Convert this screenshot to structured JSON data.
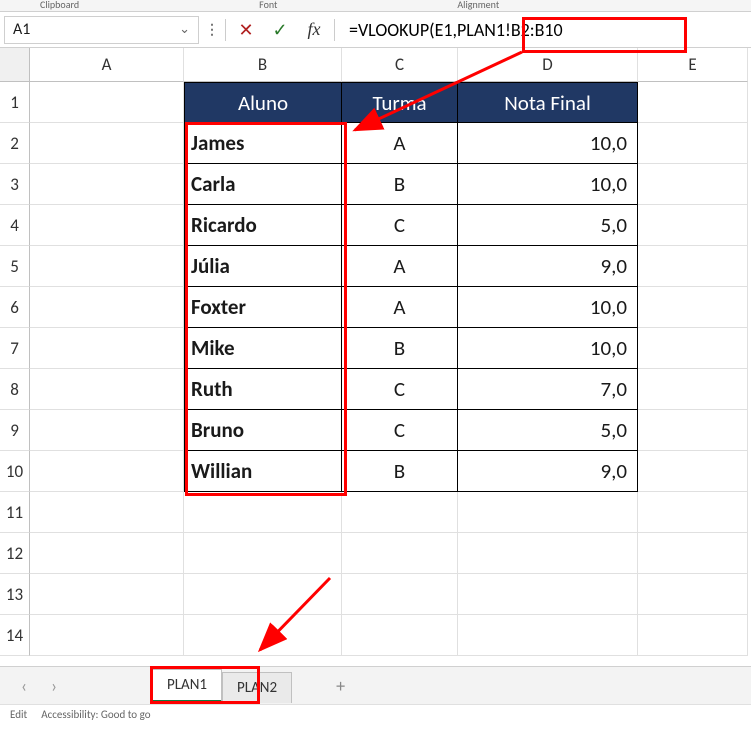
{
  "ribbon": {
    "group1": "Clipboard",
    "group2": "Font",
    "group3": "Alignment"
  },
  "name_box": "A1",
  "formula": "=VLOOKUP(E1,PLAN1!B2:B10",
  "columns": [
    "A",
    "B",
    "C",
    "D",
    "E"
  ],
  "rows": [
    "1",
    "2",
    "3",
    "4",
    "5",
    "6",
    "7",
    "8",
    "9",
    "10",
    "11",
    "12",
    "13",
    "14"
  ],
  "table": {
    "headers": {
      "aluno": "Aluno",
      "turma": "Turma",
      "nota": "Nota Final"
    },
    "data": [
      {
        "aluno": "James",
        "turma": "A",
        "nota": "10,0"
      },
      {
        "aluno": "Carla",
        "turma": "B",
        "nota": "10,0"
      },
      {
        "aluno": "Ricardo",
        "turma": "C",
        "nota": "5,0"
      },
      {
        "aluno": "Júlia",
        "turma": "A",
        "nota": "9,0"
      },
      {
        "aluno": "Foxter",
        "turma": "A",
        "nota": "10,0"
      },
      {
        "aluno": "Mike",
        "turma": "B",
        "nota": "10,0"
      },
      {
        "aluno": "Ruth",
        "turma": "C",
        "nota": "7,0"
      },
      {
        "aluno": "Bruno",
        "turma": "C",
        "nota": "5,0"
      },
      {
        "aluno": "Willian",
        "turma": "B",
        "nota": "9,0"
      }
    ]
  },
  "tabs": {
    "active": "PLAN1",
    "other": "PLAN2"
  },
  "status": {
    "mode": "Edit",
    "access": "Accessibility: Good to go"
  }
}
